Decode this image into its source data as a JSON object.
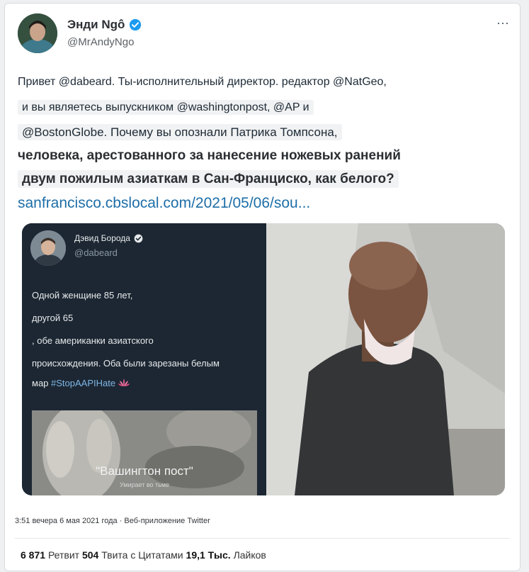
{
  "author": {
    "name": "Энди Ngô",
    "handle": "@MrAndyNgo"
  },
  "more_icon": "⋯",
  "tweet": {
    "line1": "Привет @dabeard. Ты-исполнительный директор. редактор @NatGeo,",
    "line2": "и вы являетесь выпускником @washingtonpost, @AP и",
    "line3": "@BostonGlobe. Почему вы опознали Патрика Томпсона,",
    "line4": "человека, арестованного за нанесение ножевых ранений",
    "line5": "двум пожилым азиаткам в Сан-Франциско, как белого?",
    "link": "sanfrancisco.cbslocal.com/2021/05/06/sou..."
  },
  "embedded": {
    "name": "Дэвид Борода",
    "handle": "@dabeard",
    "text1": "Одной женщине 85 лет,",
    "text2": "другой 65",
    "text3": ", обе американки азиатского",
    "text4": "происхождения. Оба были зарезаны белым",
    "text5_prefix": "мар",
    "hashtag": "#StopAAPIHate",
    "card_title": "\"Вашингтон пост\"",
    "card_sub": "Умирает во тьме"
  },
  "timestamp": "3:51 вечера 6 мая 2021 года · Веб-приложение Twitter",
  "stats": {
    "retweets_count": "6 871",
    "retweets_label": "Ретвит",
    "quotes_count": "504",
    "quotes_label": "Твита с Цитатами",
    "likes_count": "19,1 Тыс.",
    "likes_label": "Лайков"
  },
  "colors": {
    "link": "#1d6ea8",
    "verified": "#1d9bf0",
    "embed_bg": "#1c2733"
  },
  "icons": [
    "verified-badge-icon",
    "more-options-icon",
    "lotus-emoji-icon"
  ]
}
